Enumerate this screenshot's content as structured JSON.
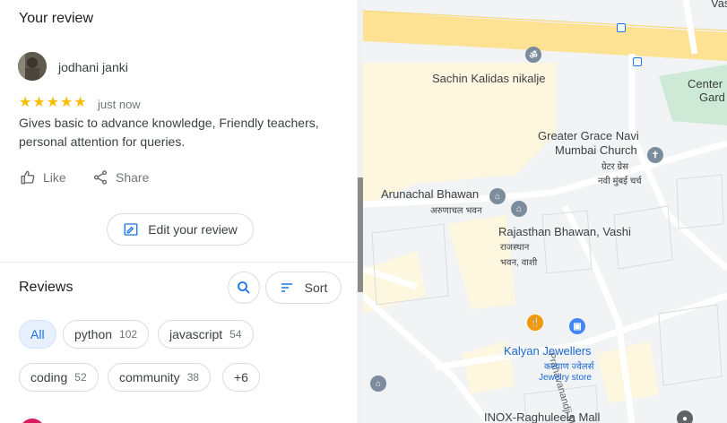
{
  "your_review": {
    "title": "Your review",
    "reviewer_name": "jodhani janki",
    "rating": 5,
    "stars": [
      "★",
      "★",
      "★",
      "★",
      "★"
    ],
    "time": "just now",
    "text": "Gives basic to advance knowledge, Friendly teachers, personal attention for queries.",
    "like_label": "Like",
    "share_label": "Share",
    "edit_label": "Edit your review"
  },
  "reviews": {
    "title": "Reviews",
    "sort_label": "Sort",
    "chips": [
      {
        "label": "All",
        "count": ""
      },
      {
        "label": "python",
        "count": "102"
      },
      {
        "label": "javascript",
        "count": "54"
      },
      {
        "label": "coding",
        "count": "52"
      },
      {
        "label": "community",
        "count": "38"
      },
      {
        "label": "+6",
        "count": ""
      }
    ]
  },
  "map": {
    "labels": {
      "sachin": "Sachin Kalidas nikalje",
      "greater_grace_1": "Greater Grace Navi",
      "greater_grace_2": "Mumbai Church",
      "greater_grace_hi_1": "ग्रेटर ग्रेस",
      "greater_grace_hi_2": "नवी मुंबई चर्च",
      "arunachal": "Arunachal Bhawan",
      "arunachal_hi": "अरुणाचल भवन",
      "rajasthan": "Rajasthan Bhawan, Vashi",
      "rajasthan_hi_1": "राजस्थान",
      "rajasthan_hi_2": "भवन, वाशी",
      "kalyan": "Kalyan Jewellers",
      "kalyan_hi": "कल्याण ज्वेलर्स",
      "jewelry_store": "Jewelry store",
      "inox": "INOX-Raghuleela Mall",
      "center_1": "Center",
      "center_2": "Gard",
      "vas": "Vas",
      "road": "Pranavanandji Marg"
    },
    "colors": {
      "highway": "#fde293",
      "building_yellow": "#fef7e0",
      "park": "#ceead6",
      "pin_gray": "#7b8c9c",
      "pin_orange": "#f29900",
      "pin_blue": "#4285f4"
    }
  }
}
